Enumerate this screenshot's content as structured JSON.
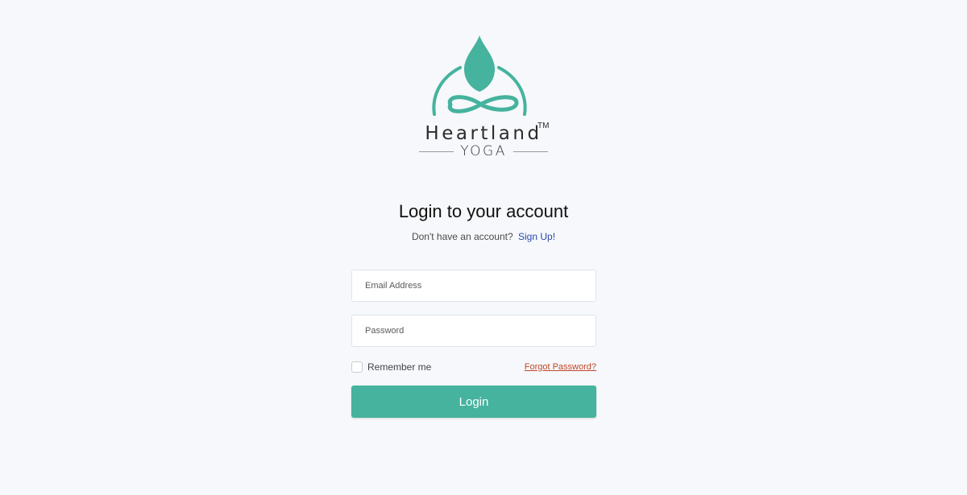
{
  "brand": {
    "name": "Heartland",
    "tm": "TM",
    "subtitle": "YOGA",
    "color": "#45b39d"
  },
  "heading": "Login to your account",
  "signup": {
    "prompt": "Don't have an account?",
    "link_label": "Sign Up!"
  },
  "form": {
    "email_placeholder": "Email Address",
    "password_placeholder": "Password",
    "remember_label": "Remember me",
    "remember_checked": false,
    "forgot_label": "Forgot Password?",
    "submit_label": "Login"
  },
  "colors": {
    "accent": "#45b39d",
    "link": "#2a49a6",
    "forgot": "#c0462a",
    "background": "#f6f8fb"
  },
  "icons": [
    "yoga-meditation-logo-icon"
  ]
}
